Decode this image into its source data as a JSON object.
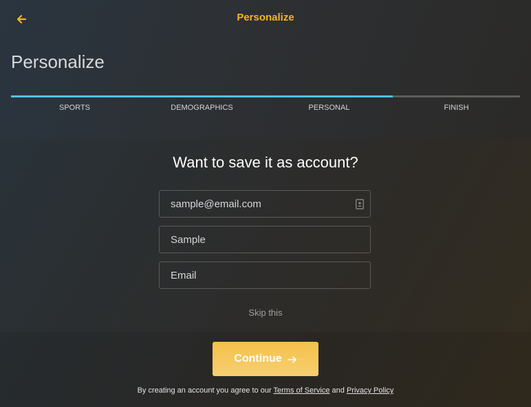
{
  "header": {
    "topbar_title": "Personalize",
    "page_title": "Personalize",
    "back_icon": "arrow-left-icon"
  },
  "progress": {
    "completed_fraction": 0.75,
    "steps": [
      {
        "label": "SPORTS"
      },
      {
        "label": "DEMOGRAPHICS"
      },
      {
        "label": "PERSONAL"
      },
      {
        "label": "FINISH"
      }
    ]
  },
  "form": {
    "question": "Want to save it as account?",
    "fields": [
      {
        "placeholder": "sample@email.com",
        "value": "",
        "icon": "contact-card-icon"
      },
      {
        "placeholder": "Sample",
        "value": ""
      },
      {
        "placeholder": "Email",
        "value": ""
      }
    ],
    "skip_label": "Skip this"
  },
  "footer": {
    "continue_label": "Continue",
    "legal_prefix": "By creating an account you agree to our",
    "terms_label": "Terms of Service",
    "and_text": "and",
    "privacy_label": "Privacy Policy"
  },
  "colors": {
    "accent": "#f3b61f",
    "progress": "#4fc3f7",
    "button": "#f5c65a"
  }
}
